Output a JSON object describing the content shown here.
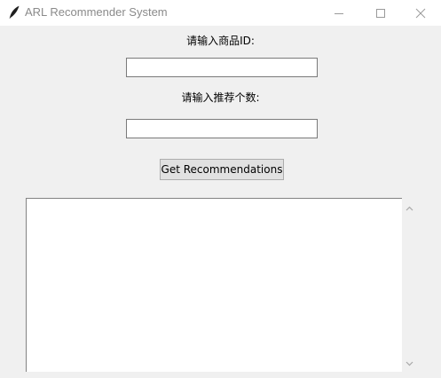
{
  "window": {
    "title": "ARL Recommender System",
    "icon": "feather-icon",
    "controls": [
      "minimize-icon",
      "maximize-icon",
      "close-icon"
    ]
  },
  "form": {
    "product_id_label": "请输入商品ID:",
    "product_id_value": "",
    "count_label": "请输入推荐个数:",
    "count_value": "",
    "submit_label": "Get Recommendations"
  },
  "results": {
    "text": ""
  },
  "colors": {
    "window_bg": "#f0f0f0",
    "titlebar_bg": "#ffffff",
    "button_bg": "#e1e1e1",
    "input_border": "#7a7a7a"
  }
}
